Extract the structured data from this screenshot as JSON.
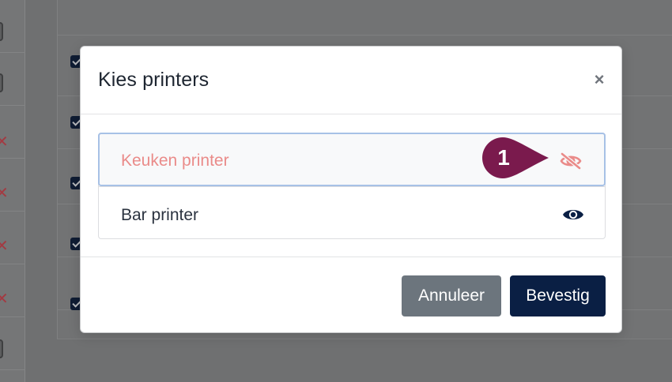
{
  "modal": {
    "title": "Kies printers",
    "close_glyph": "×",
    "printers": [
      {
        "label": "Keuken printer",
        "state": "hidden",
        "icon": "eye-slash-icon"
      },
      {
        "label": "Bar printer",
        "state": "visible",
        "icon": "eye-icon"
      }
    ],
    "cancel_label": "Annuleer",
    "confirm_label": "Bevestig"
  },
  "callout": {
    "number": "1"
  },
  "colors": {
    "primary_navy": "#0a1f44",
    "secondary_gray": "#6c757d",
    "hidden_text": "#ea8b89",
    "focus_border": "#a7c1e6",
    "callout": "#7a1a4d"
  }
}
